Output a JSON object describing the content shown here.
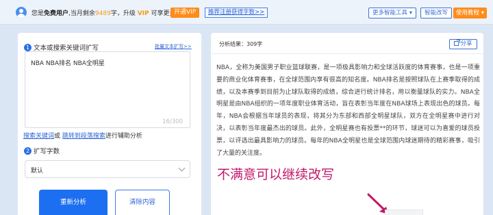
{
  "topbar": {
    "greeting": "您是",
    "user_type": "免费用户",
    "remain_prefix": ",当月剩余",
    "remain_count": "9489",
    "remain_suffix": "字，升级",
    "vip_word": "VIP",
    "more_text": "可享更多字数",
    "vip_button": "开通VIP",
    "register_link": "推荐注册获得字数>>",
    "more_tools": "更多智能工具 ▾",
    "smart_rewrite": "智能改写",
    "tutorial": "使用教程 ▾"
  },
  "left": {
    "step1_num": "1",
    "step1_label": "文本或搜索关键词扩写",
    "batch_link": "批量文本扩写>>",
    "input_value": "NBA NBA排名 NBA全明星",
    "char_count": "16/300",
    "helper_link1": "搜索关键词",
    "helper_or": "或",
    "helper_link2": "跳转到段落搜索",
    "helper_suffix": "进行辅助分析",
    "step2_num": "2",
    "step2_label": "扩写字数",
    "select_value": "默认",
    "rewrite_button": "重新分析",
    "clear_button": "清除内容"
  },
  "right": {
    "result_label": "分析结果：309字",
    "share_button": "分享",
    "article": "NBA，全称为美国男子职业篮球联赛，是一项极具影响力和全球活跃度的体育赛事，也是一项重要的商业化体育赛事，在全球范围内享有很高的知名度。NBA排名是按照球队在上赛季取得的成绩，以及本赛季到目前为止球队取得的成绩，综合进行统计排名，用以衡量球队的实力。NBA全明星是由NBA组织的一项年度职业体育活动，旨在表彰当年度在NBA球场上表现出色的球员。每年，NBA会根据当年球员的表现，将其分为东部和西部全明星球队，双方在全明星赛中进行对决，以表彰当年度最杰出的球员。此外，全明星赛也有投票**的环节，球迷可以为喜爱的球员投票，以评选出最具影响力的球员。每年的NBA全明星也是全球范围内球迷期待的精彩赛事，吸引了大量的关注度。",
    "overlay_text": "不满意可以继续改写"
  },
  "colors": {
    "primary": "#1c6ff0",
    "orange": "#ff8c1a",
    "overlay": "#c2186b"
  }
}
